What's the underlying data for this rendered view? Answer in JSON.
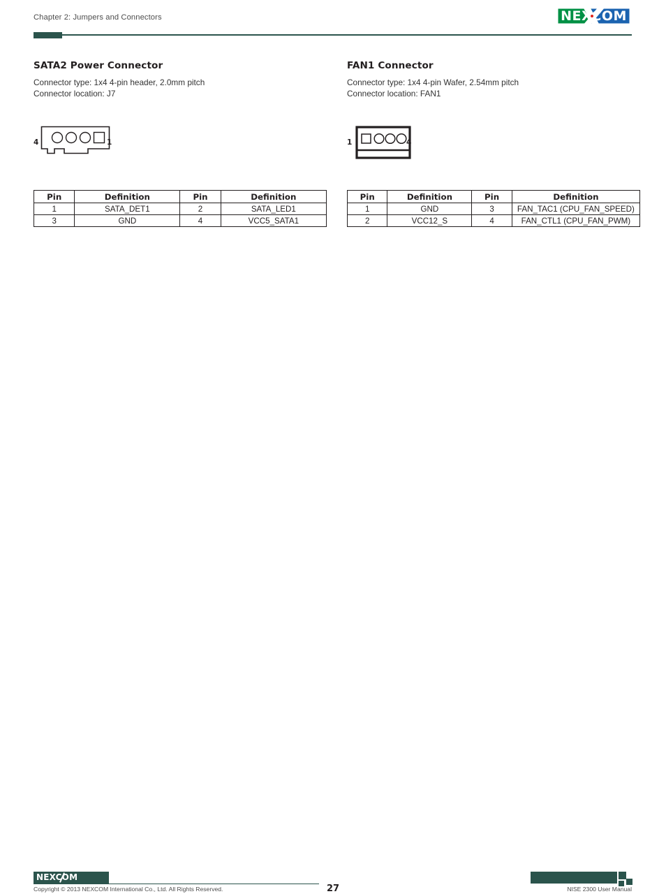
{
  "header": {
    "chapter_label": "Chapter 2: Jumpers and Connectors",
    "logo": {
      "text_green": "NE",
      "text_blue": "COM",
      "full_text": "NEXCOM",
      "color_green": "#009045",
      "color_blue": "#1b63b0",
      "color_dot": "#e2231a"
    },
    "accent_color": "#2b544c"
  },
  "sections": {
    "left": {
      "title": "SATA2 Power Connector",
      "connector_type": "Connector type: 1x4 4-pin header, 2.0mm pitch",
      "connector_location": "Connector location: J7",
      "diagram": {
        "pin_start_label": "4",
        "pin_end_label": "1",
        "pad_shapes": [
          "circle",
          "circle",
          "circle",
          "square"
        ],
        "style": "header-with-notches"
      },
      "table": {
        "headers": [
          "Pin",
          "Definition",
          "Pin",
          "Definition"
        ],
        "rows": [
          [
            "1",
            "SATA_DET1",
            "2",
            "SATA_LED1"
          ],
          [
            "3",
            "GND",
            "4",
            "VCC5_SATA1"
          ]
        ]
      }
    },
    "right": {
      "title": "FAN1 Connector",
      "connector_type": "Connector type: 1x4 4-pin Wafer, 2.54mm pitch",
      "connector_location": "Connector location: FAN1",
      "diagram": {
        "pin_start_label": "1",
        "pin_end_label": "4",
        "pad_shapes": [
          "square",
          "circle",
          "circle",
          "circle"
        ],
        "style": "wafer-box"
      },
      "table": {
        "headers": [
          "Pin",
          "Definition",
          "Pin",
          "Definition"
        ],
        "rows": [
          [
            "1",
            "GND",
            "3",
            "FAN_TAC1 (CPU_FAN_SPEED)"
          ],
          [
            "2",
            "VCC12_S",
            "4",
            "FAN_CTL1 (CPU_FAN_PWM)"
          ]
        ]
      }
    }
  },
  "footer": {
    "logo_text": "NEXCOM",
    "copyright": "Copyright © 2013 NEXCOM International Co., Ltd. All Rights Reserved.",
    "page_number": "27",
    "manual_title": "NISE 2300 User Manual",
    "accent_color": "#2b544c"
  }
}
